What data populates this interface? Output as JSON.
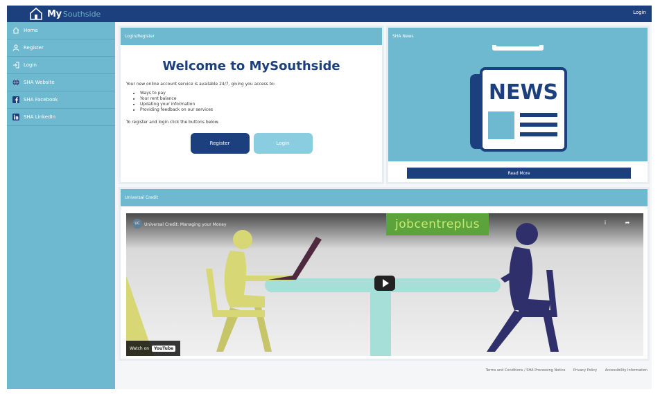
{
  "header": {
    "brand_my": "My",
    "brand_rest": "Southside",
    "login_label": "Login"
  },
  "sidebar": {
    "items": [
      {
        "label": "Home",
        "icon": "home-icon"
      },
      {
        "label": "Register",
        "icon": "user-icon"
      },
      {
        "label": "Login",
        "icon": "login-icon"
      },
      {
        "label": "SHA Website",
        "icon": "globe-icon"
      },
      {
        "label": "SHA Facebook",
        "icon": "facebook-icon"
      },
      {
        "label": "SHA LinkedIn",
        "icon": "linkedin-icon"
      }
    ]
  },
  "login_card": {
    "header": "Login/Register",
    "title": "Welcome to MySouthside",
    "intro": "Your new online account service is available 24/7, giving you access to:",
    "bullets": [
      "Ways to pay",
      "Your rent balance",
      "Updating your information",
      "Providing feedback on our services"
    ],
    "register_note": "To register and login click the buttons below.",
    "register_button": "Register",
    "login_button": "Login"
  },
  "news_card": {
    "header": "SHA News",
    "image_text": "NEWS",
    "read_more": "Read More"
  },
  "video_card": {
    "header": "Universal Credit",
    "video_title": "Universal Credit: Managing your Money",
    "channel_badge": "UC",
    "overlay_brand": "jobcentreplus",
    "watch_on": "Watch on",
    "youtube": "YouTube",
    "info_icon": "i",
    "share_icon": "➦"
  },
  "footer": {
    "links": [
      "Terms and Conditions / SHA Processing Notice",
      "Privacy Policy",
      "Accessibility Information"
    ]
  },
  "colors": {
    "navy": "#1c3f7d",
    "teal": "#6eb9cf",
    "light_teal": "#8acde0"
  }
}
